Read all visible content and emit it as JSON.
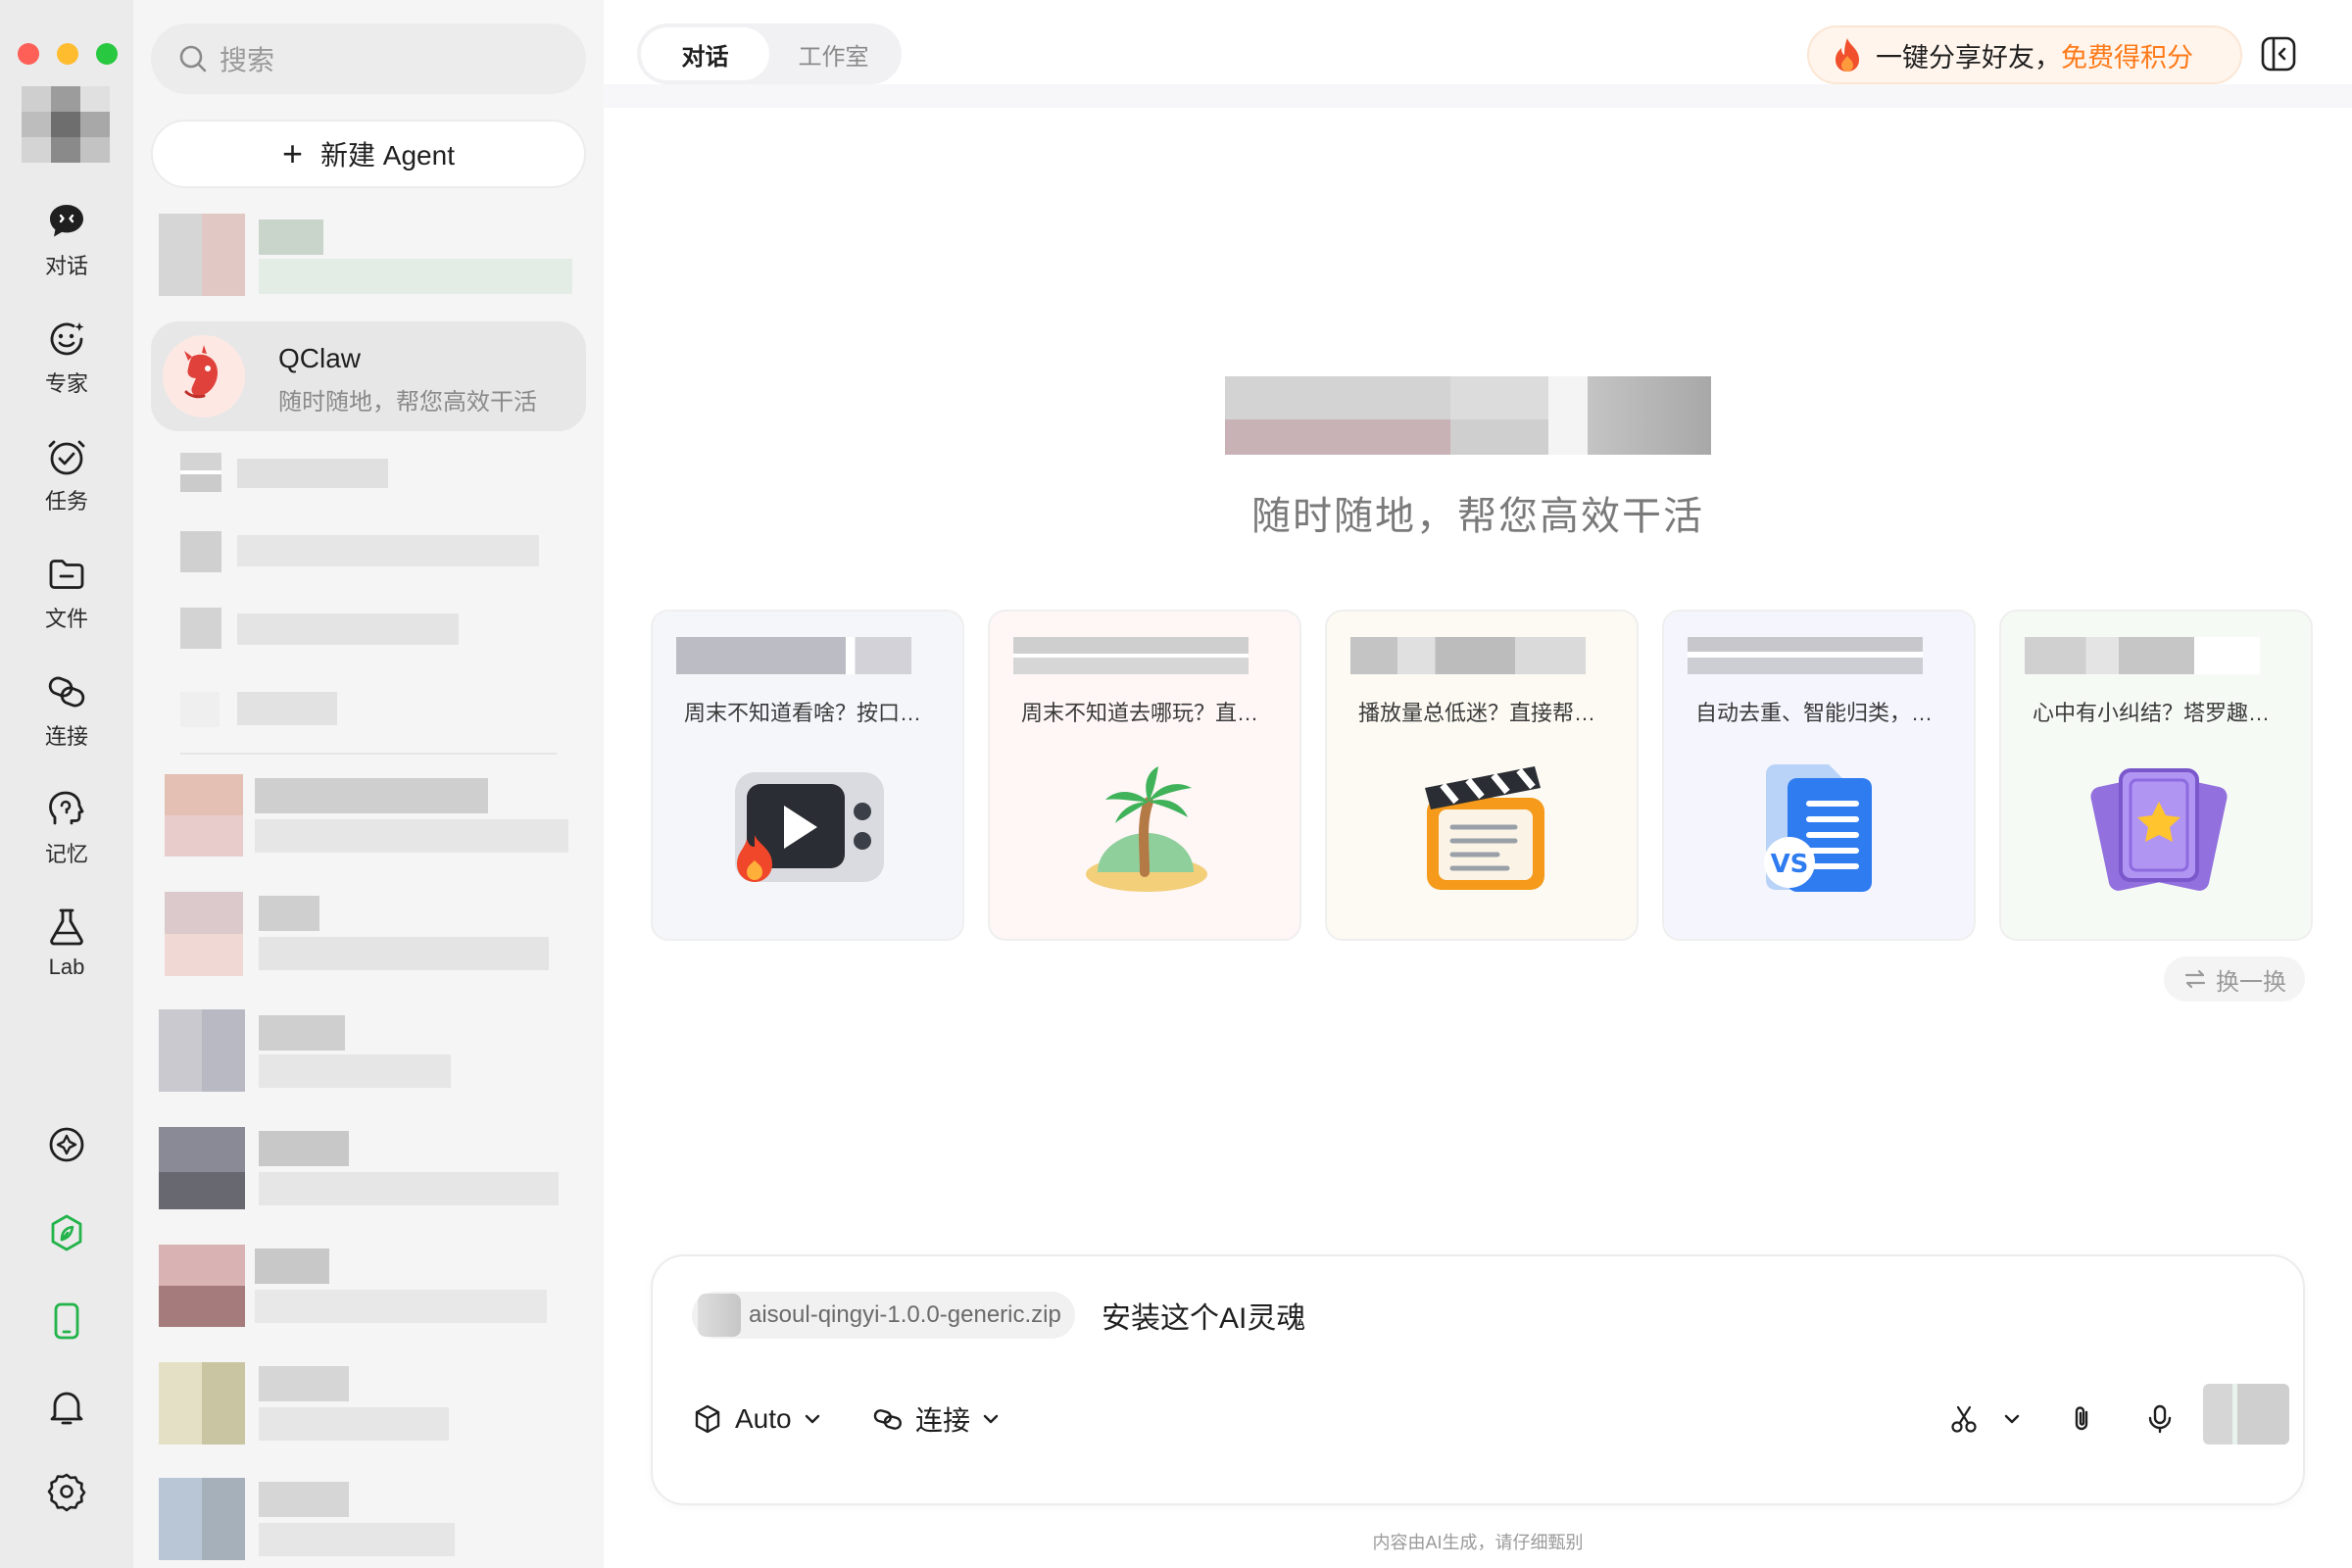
{
  "window": {
    "title": ""
  },
  "rail": {
    "items": [
      {
        "label": "对话",
        "icon": "chat-icon"
      },
      {
        "label": "专家",
        "icon": "expert-icon"
      },
      {
        "label": "任务",
        "icon": "task-icon"
      },
      {
        "label": "文件",
        "icon": "folder-icon"
      },
      {
        "label": "连接",
        "icon": "link-icon"
      },
      {
        "label": "记忆",
        "icon": "memory-icon"
      },
      {
        "label": "Lab",
        "icon": "flask-icon"
      }
    ],
    "bottom_icons": [
      "compass-icon",
      "leaf-icon",
      "phone-icon",
      "bell-icon",
      "settings-icon"
    ],
    "accent_green": "#22b34a"
  },
  "sidebar": {
    "search_placeholder": "搜索",
    "new_agent_label": "新建 Agent",
    "active_agent": {
      "name": "QClaw",
      "description": "随时随地，帮您高效干活"
    }
  },
  "header": {
    "tabs": [
      {
        "label": "对话",
        "active": true
      },
      {
        "label": "工作室",
        "active": false
      }
    ],
    "share": {
      "text": "一键分享好友，",
      "highlight": "免费得积分",
      "highlight_color": "#ff7a1a"
    }
  },
  "hero": {
    "subtitle": "随时随地，帮您高效干活"
  },
  "cards": [
    {
      "desc": "周末不知道看啥？按口味推荐，直接列出片单",
      "icon": "tv-fire-icon",
      "bg": "#f5f6fa"
    },
    {
      "desc": "周末不知道去哪玩？直接推荐附近好去处",
      "icon": "palm-island-icon",
      "bg": "#fff6f6"
    },
    {
      "desc": "播放量总低迷？直接帮你分析爆款选题",
      "icon": "clapperboard-icon",
      "bg": "#fcfaf3"
    },
    {
      "desc": "自动去重、智能归类，整理你的文档",
      "icon": "document-vs-icon",
      "bg": "#f5f5fd"
    },
    {
      "desc": "心中有小纠结？塔罗趣味占卜帮你解惑",
      "icon": "tarot-cards-icon",
      "bg": "#f6faf4"
    }
  ],
  "swap_label": "换一换",
  "composer": {
    "attachment": "aisoul-qingyi-1.0.0-generic.zip",
    "text": "安装这个AI灵魂",
    "mode_label": "Auto",
    "connect_label": "连接"
  },
  "footer_note": "内容由AI生成，请仔细甄别"
}
